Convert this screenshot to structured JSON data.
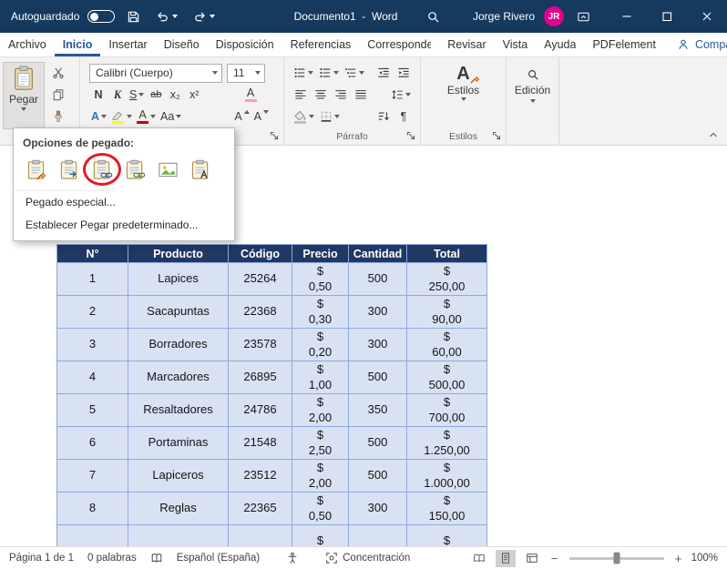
{
  "colors": {
    "titlebar": "#16395E",
    "accent": "#2B579A",
    "tableHeader": "#1F3864",
    "tableRow": "#D9E2F3",
    "tableBorder": "#8EAADB",
    "avatar": "#E3008C",
    "annotation": "#E11B22",
    "highlightYellow": "#FFFF00",
    "fontColorRed": "#C00000"
  },
  "titlebar": {
    "autosave_label": "Autoguardado",
    "document_title": "Documento1  -  Word",
    "user_name": "Jorge Rivero",
    "user_initials": "JR"
  },
  "tabs": {
    "items": [
      "Archivo",
      "Inicio",
      "Insertar",
      "Diseño",
      "Disposición",
      "Referencias",
      "Correspondencia",
      "Revisar",
      "Vista",
      "Ayuda",
      "PDFelement"
    ],
    "selected_tab": "Inicio",
    "share_label": "Compartir"
  },
  "ribbon": {
    "paste_label": "Pegar",
    "font_name": "Calibri (Cuerpo)",
    "font_size": "11",
    "glyphs": {
      "bold": "N",
      "italic": "K",
      "underline": "S",
      "strikethrough": "ab",
      "subscript": "x₂",
      "superscript": "x²",
      "clear_format": "A",
      "text_effects": "A",
      "font_color": "A",
      "change_case": "Aa",
      "grow_font": "A",
      "shrink_font": "A",
      "styles_icon": "A",
      "pilcrow": "¶"
    },
    "group_labels": {
      "paragraph": "Párrafo",
      "styles": "Estilos"
    },
    "styles_button_label": "Estilos",
    "editing_button_label": "Edición"
  },
  "paste_menu": {
    "title": "Opciones de pegado:",
    "options": [
      {
        "icon": "paste-keep-source-formatting-icon",
        "annotated": false
      },
      {
        "icon": "paste-use-destination-styles-icon",
        "annotated": false
      },
      {
        "icon": "paste-link-keep-source-formatting-icon",
        "annotated": true
      },
      {
        "icon": "paste-link-use-destination-styles-icon",
        "annotated": false
      },
      {
        "icon": "paste-picture-icon",
        "annotated": false
      },
      {
        "icon": "paste-keep-text-only-icon",
        "annotated": false
      }
    ],
    "item_paste_special": "Pegado especial...",
    "item_set_default": "Establecer Pegar predeterminado..."
  },
  "table": {
    "headers": [
      "N°",
      "Producto",
      "Código",
      "Precio",
      "Cantidad",
      "Total"
    ],
    "rows": [
      {
        "n": "1",
        "producto": "Lapices",
        "codigo": "25264",
        "precio": "$\n0,50",
        "cantidad": "500",
        "total": "$\n250,00"
      },
      {
        "n": "2",
        "producto": "Sacapuntas",
        "codigo": "22368",
        "precio": "$\n0,30",
        "cantidad": "300",
        "total": "$\n90,00"
      },
      {
        "n": "3",
        "producto": "Borradores",
        "codigo": "23578",
        "precio": "$\n0,20",
        "cantidad": "300",
        "total": "$\n60,00"
      },
      {
        "n": "4",
        "producto": "Marcadores",
        "codigo": "26895",
        "precio": "$\n1,00",
        "cantidad": "500",
        "total": "$\n500,00"
      },
      {
        "n": "5",
        "producto": "Resaltadores",
        "codigo": "24786",
        "precio": "$\n2,00",
        "cantidad": "350",
        "total": "$\n700,00"
      },
      {
        "n": "6",
        "producto": "Portaminas",
        "codigo": "21548",
        "precio": "$\n2,50",
        "cantidad": "500",
        "total": "$\n1.250,00"
      },
      {
        "n": "7",
        "producto": "Lapiceros",
        "codigo": "23512",
        "precio": "$\n2,00",
        "cantidad": "500",
        "total": "$\n1.000,00"
      },
      {
        "n": "8",
        "producto": "Reglas",
        "codigo": "22365",
        "precio": "$\n0,50",
        "cantidad": "300",
        "total": "$\n150,00"
      },
      {
        "n": "",
        "producto": "",
        "codigo": "",
        "precio": "$",
        "cantidad": "",
        "total": "$"
      }
    ]
  },
  "statusbar": {
    "page_indicator": "Página 1 de 1",
    "word_count": "0 palabras",
    "language": "Español (España)",
    "focus_label": "Concentración",
    "zoom_out": "−",
    "zoom_in": "+",
    "zoom_level": "100%"
  }
}
